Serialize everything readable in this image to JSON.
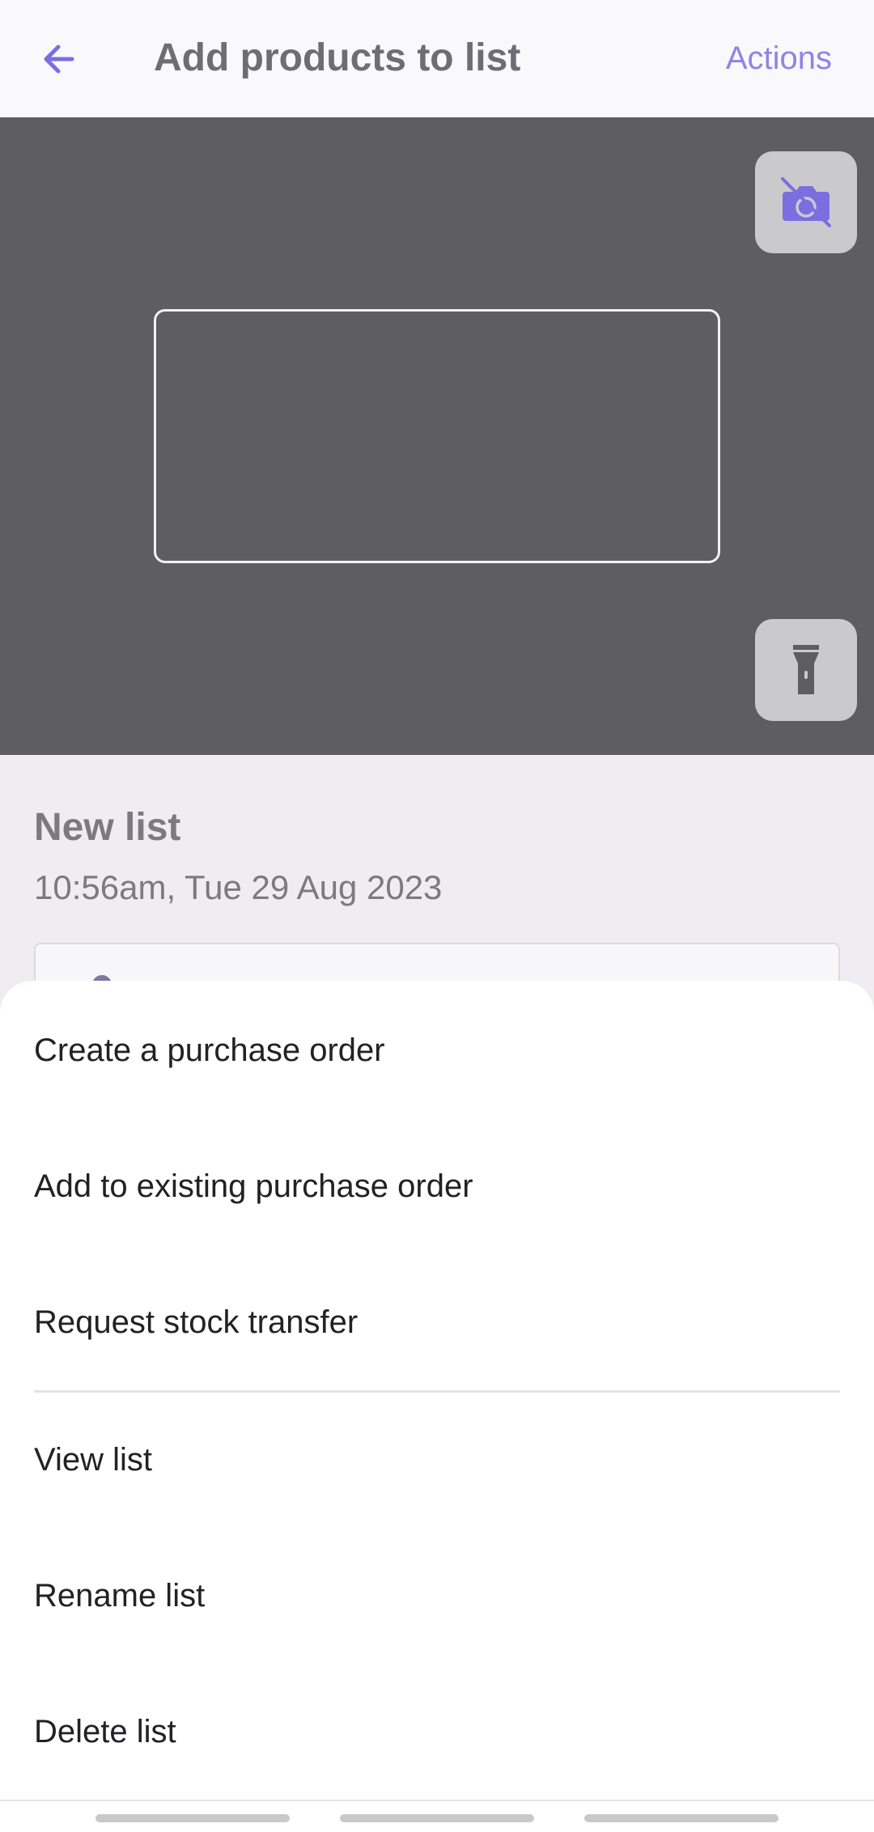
{
  "header": {
    "title": "Add products to list",
    "actions_label": "Actions",
    "back_icon": "back-arrow-icon"
  },
  "camera": {
    "switch_camera_icon": "switch-camera-icon",
    "flashlight_icon": "flashlight-icon"
  },
  "list": {
    "name": "New list",
    "timestamp": "10:56am, Tue 29 Aug 2023"
  },
  "actions_sheet": {
    "items": [
      {
        "label": "Create a purchase order"
      },
      {
        "label": "Add to existing purchase order"
      },
      {
        "label": "Request stock transfer"
      },
      {
        "label": "View list"
      },
      {
        "label": "Rename list"
      },
      {
        "label": "Delete list"
      }
    ]
  },
  "colors": {
    "accent": "#7b6ee0",
    "camera_bg": "#5e5e60",
    "text_primary": "#222226"
  }
}
